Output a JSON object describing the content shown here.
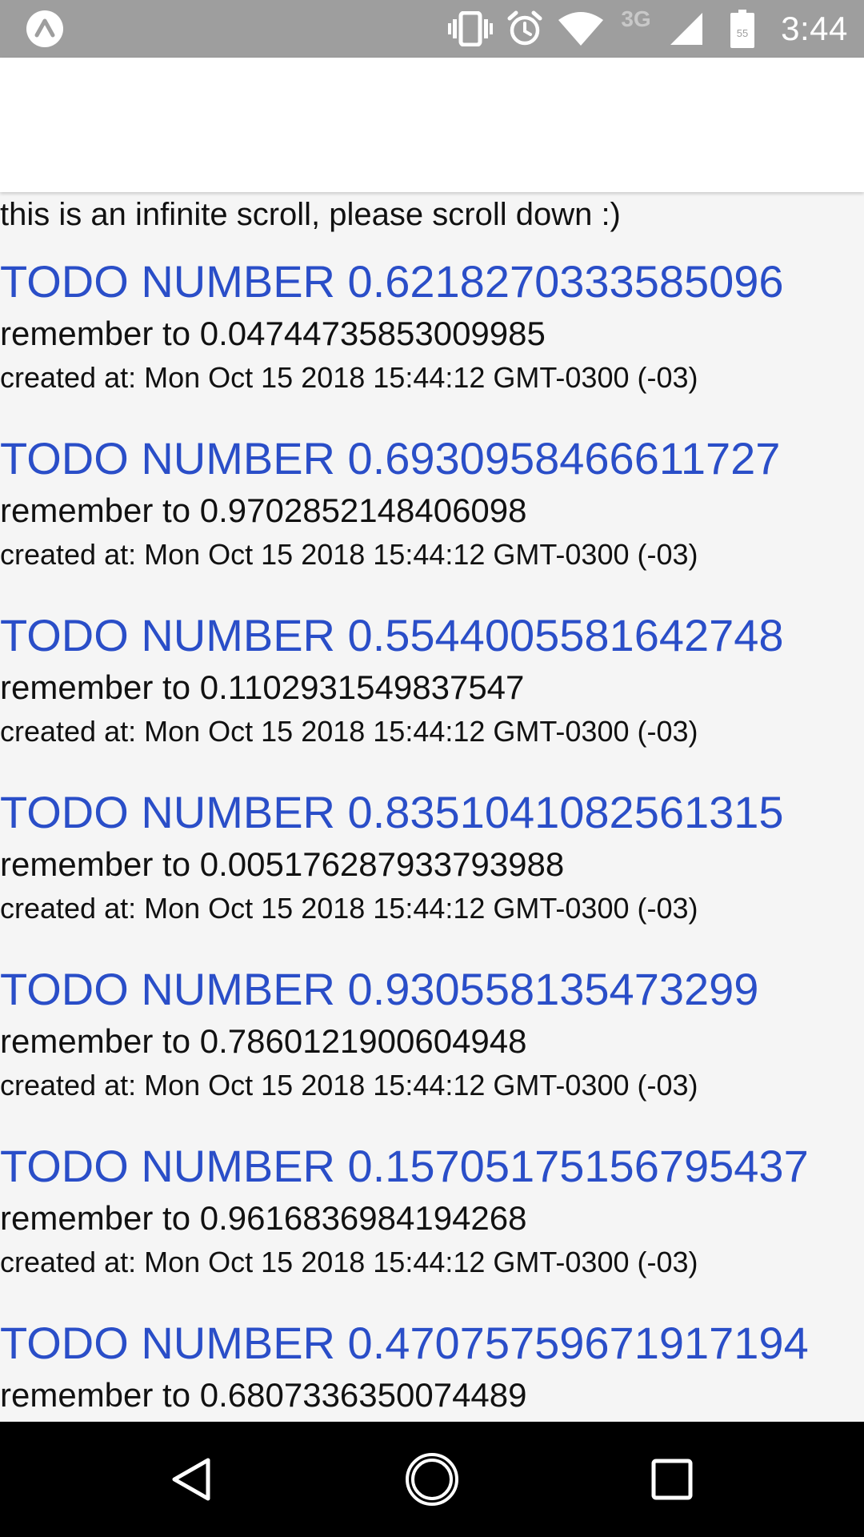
{
  "status_bar": {
    "app_icon": "app-logo-icon",
    "icons": [
      "vibrate-icon",
      "alarm-icon",
      "wifi-icon",
      "signal-icon",
      "battery-icon"
    ],
    "network_type": "3G",
    "battery_level": "55",
    "time": "3:44",
    "background_color": "#9e9e9e"
  },
  "content": {
    "intro": "this is an infinite scroll, please scroll down :)",
    "todos": [
      {
        "title": "TODO NUMBER 0.6218270333585096",
        "remember": "remember to 0.04744735853009985",
        "created": "created at: Mon Oct 15 2018 15:44:12 GMT-0300 (-03)"
      },
      {
        "title": "TODO NUMBER 0.6930958466611727",
        "remember": "remember to 0.9702852148406098",
        "created": "created at: Mon Oct 15 2018 15:44:12 GMT-0300 (-03)"
      },
      {
        "title": "TODO NUMBER 0.5544005581642748",
        "remember": "remember to 0.1102931549837547",
        "created": "created at: Mon Oct 15 2018 15:44:12 GMT-0300 (-03)"
      },
      {
        "title": "TODO NUMBER 0.835104108256131​5",
        "remember": "remember to 0.005176287933793988",
        "created": "created at: Mon Oct 15 2018 15:44:12 GMT-0300 (-03)"
      },
      {
        "title": "TODO NUMBER 0.930558135473299",
        "remember": "remember to 0.7860121900604948",
        "created": "created at: Mon Oct 15 2018 15:44:12 GMT-0300 (-03)"
      },
      {
        "title": "TODO NUMBER 0.1570517515679543​7",
        "remember": "remember to 0.9616836984194268",
        "created": "created at: Mon Oct 15 2018 15:44:12 GMT-0300 (-03)"
      },
      {
        "title": "TODO NUMBER 0.4707575967191719​4",
        "remember": "remember to 0.6807336350074489",
        "created": ""
      }
    ],
    "title_color": "#2a4ec8"
  },
  "nav_bar": {
    "back_icon": "back-triangle-icon",
    "home_icon": "home-circle-icon",
    "recents_icon": "recents-square-icon"
  }
}
